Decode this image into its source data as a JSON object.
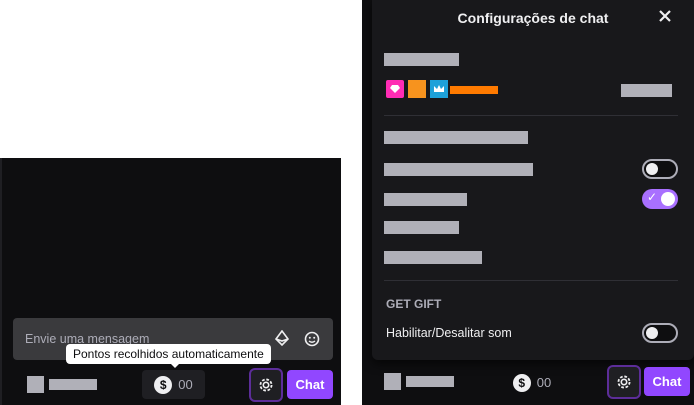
{
  "left": {
    "input": {
      "placeholder": "Envie uma mensagem"
    },
    "tooltip": "Pontos recolhidos automaticamente",
    "points": "00",
    "chat_button": "Chat"
  },
  "settings": {
    "title": "Configurações de chat",
    "section_label": "GET GIFT",
    "sound_toggle_label": "Habilitar/Desalitar som",
    "toggles": {
      "first": false,
      "second": true,
      "sound": false
    },
    "badge_colors": [
      "#ff2cb4",
      "#f7931e",
      "#1da1d9",
      "#ff7a00"
    ]
  },
  "right": {
    "points": "00",
    "chat_button": "Chat"
  }
}
